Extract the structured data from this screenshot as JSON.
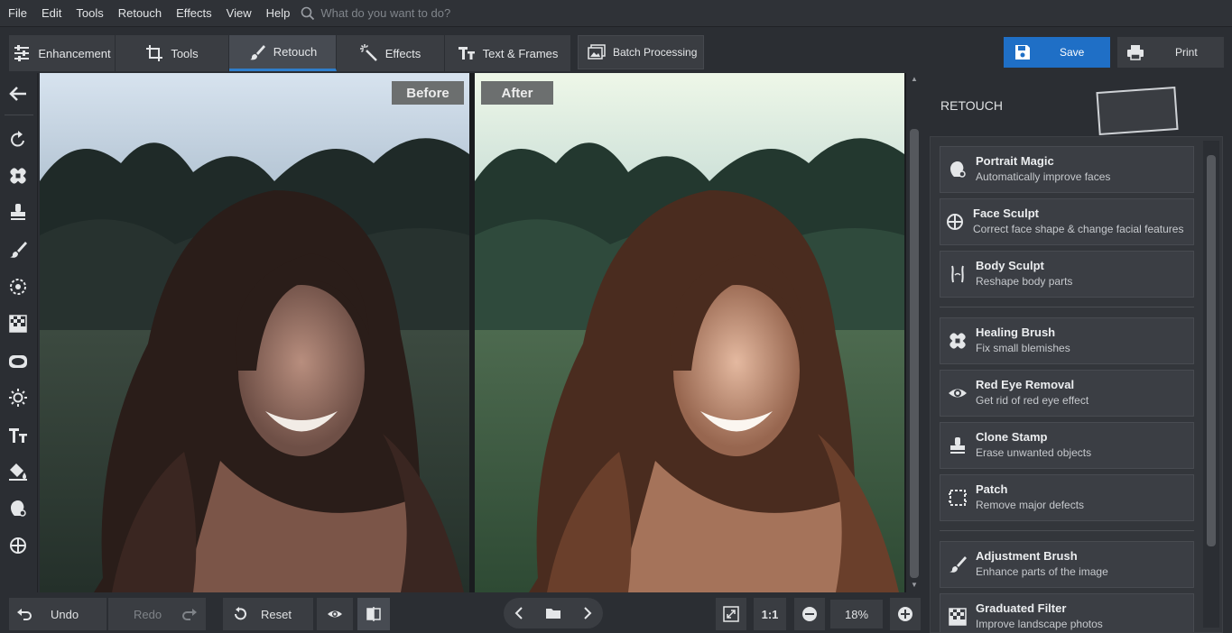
{
  "menu": {
    "items": [
      "File",
      "Edit",
      "Tools",
      "Retouch",
      "Effects",
      "View",
      "Help"
    ],
    "search_placeholder": "What do you want to do?"
  },
  "tabs": [
    {
      "label": "Enhancement",
      "icon": "sliders-icon"
    },
    {
      "label": "Tools",
      "icon": "crop-icon"
    },
    {
      "label": "Retouch",
      "icon": "brush-icon",
      "active": true
    },
    {
      "label": "Effects",
      "icon": "magic-wand-icon"
    },
    {
      "label": "Text & Frames",
      "icon": "text-icon"
    }
  ],
  "batch": {
    "label": "Batch Processing"
  },
  "actions": {
    "save": "Save",
    "print": "Print"
  },
  "canvas": {
    "before_label": "Before",
    "after_label": "After"
  },
  "panel": {
    "title": "RETOUCH",
    "items": [
      {
        "title": "Portrait Magic",
        "desc": "Automatically improve faces",
        "icon": "portrait-magic-icon"
      },
      {
        "title": "Face Sculpt",
        "desc": "Correct face shape & change facial features",
        "icon": "face-sculpt-icon"
      },
      {
        "title": "Body Sculpt",
        "desc": "Reshape body parts",
        "icon": "body-sculpt-icon"
      },
      {
        "title": "Healing Brush",
        "desc": "Fix small blemishes",
        "icon": "bandage-icon"
      },
      {
        "title": "Red Eye Removal",
        "desc": "Get rid of red eye effect",
        "icon": "eye-icon"
      },
      {
        "title": "Clone Stamp",
        "desc": "Erase unwanted objects",
        "icon": "stamp-icon"
      },
      {
        "title": "Patch",
        "desc": "Remove major defects",
        "icon": "patch-icon"
      },
      {
        "title": "Adjustment Brush",
        "desc": "Enhance parts of the image",
        "icon": "brush-icon"
      },
      {
        "title": "Graduated Filter",
        "desc": "Improve landscape photos",
        "icon": "gradient-icon"
      }
    ]
  },
  "bottom": {
    "undo": "Undo",
    "redo": "Redo",
    "reset": "Reset",
    "one_to_one": "1:1",
    "zoom": "18%"
  },
  "colors": {
    "accent": "#2f7ecb",
    "save_bg": "#1f6fc6",
    "panel_bg": "#2b2e33"
  }
}
